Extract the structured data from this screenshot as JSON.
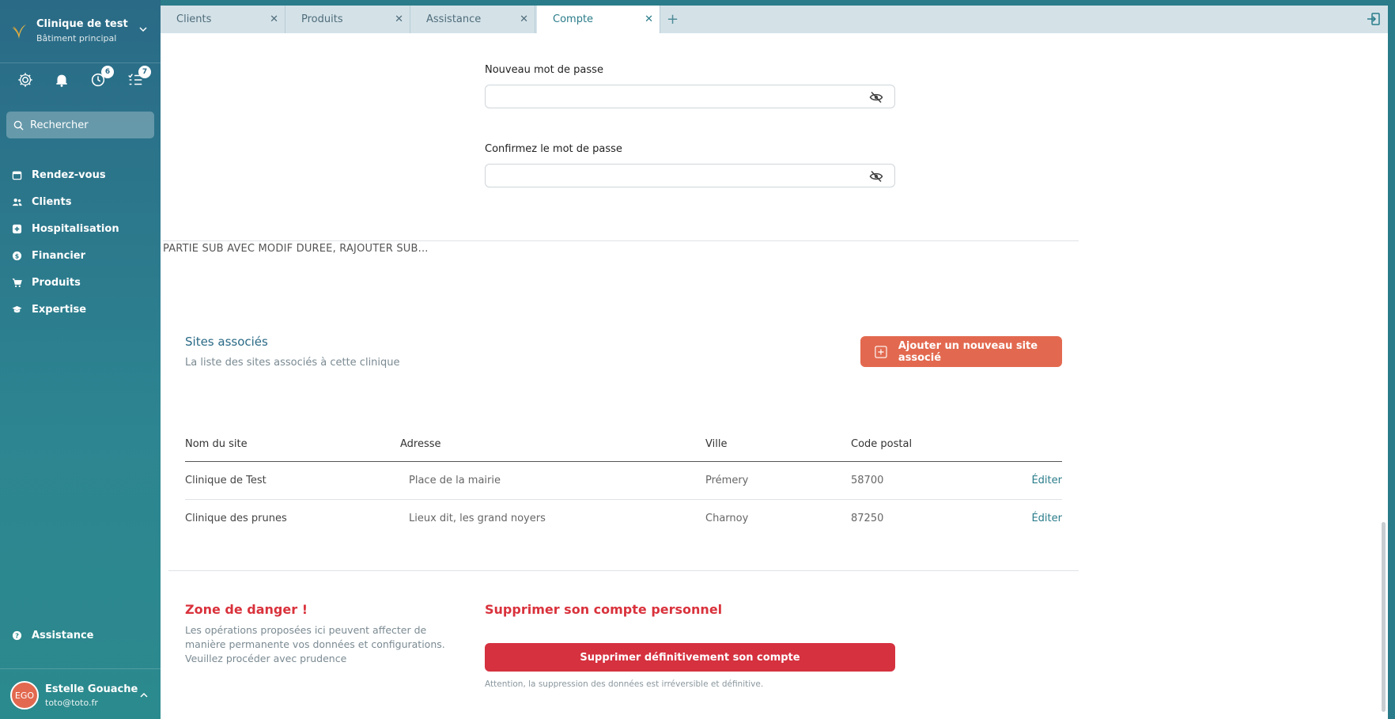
{
  "sidebar": {
    "clinic_name": "Clinique de test",
    "clinic_sub": "Bâtiment principal",
    "badges": {
      "history": "6",
      "tasks": "7"
    },
    "search_placeholder": "Rechercher",
    "nav": [
      {
        "label": "Rendez-vous",
        "icon": "calendar-icon"
      },
      {
        "label": "Clients",
        "icon": "users-icon"
      },
      {
        "label": "Hospitalisation",
        "icon": "medical-plus-icon"
      },
      {
        "label": "Financier",
        "icon": "dollar-icon"
      },
      {
        "label": "Produits",
        "icon": "cart-icon"
      },
      {
        "label": "Expertise",
        "icon": "graduation-cap-icon"
      }
    ],
    "assistance": "Assistance",
    "user": {
      "initials": "EGO",
      "name": "Estelle Gouache",
      "email": "toto@toto.fr"
    }
  },
  "tabs": [
    {
      "label": "Clients",
      "active": false
    },
    {
      "label": "Produits",
      "active": false
    },
    {
      "label": "Assistance",
      "active": false
    },
    {
      "label": "Compte",
      "active": true
    }
  ],
  "password": {
    "new_label": "Nouveau mot de passe",
    "confirm_label": "Confirmez le mot de passe"
  },
  "note": "PARTIE SUB AVEC MODIF DUREE, RAJOUTER SUB...",
  "sites": {
    "title": "Sites associés",
    "subtitle": "La liste des sites associés à cette clinique",
    "add_button": "Ajouter un nouveau site associé",
    "columns": [
      "Nom du site",
      "Adresse",
      "Ville",
      "Code postal"
    ],
    "rows": [
      {
        "name": "Clinique de Test",
        "address": "Place de la mairie",
        "city": "Prémery",
        "zip": "58700",
        "action": "Éditer"
      },
      {
        "name": "Clinique des prunes",
        "address": "Lieux dit, les grand noyers",
        "city": "Charnoy",
        "zip": "87250",
        "action": "Éditer"
      }
    ]
  },
  "danger": {
    "title": "Zone de danger !",
    "text": "Les opérations proposées ici peuvent affecter de manière permanente vos données et configurations. Veuillez procéder avec prudence",
    "delete_title": "Supprimer son compte personnel",
    "delete_button": "Supprimer définitivement son compte",
    "warning": "Attention, la suppression des données est irréversible et définitive."
  },
  "colors": {
    "accent": "#2a7c8a",
    "action": "#e2694f",
    "danger": "#d5313f"
  }
}
